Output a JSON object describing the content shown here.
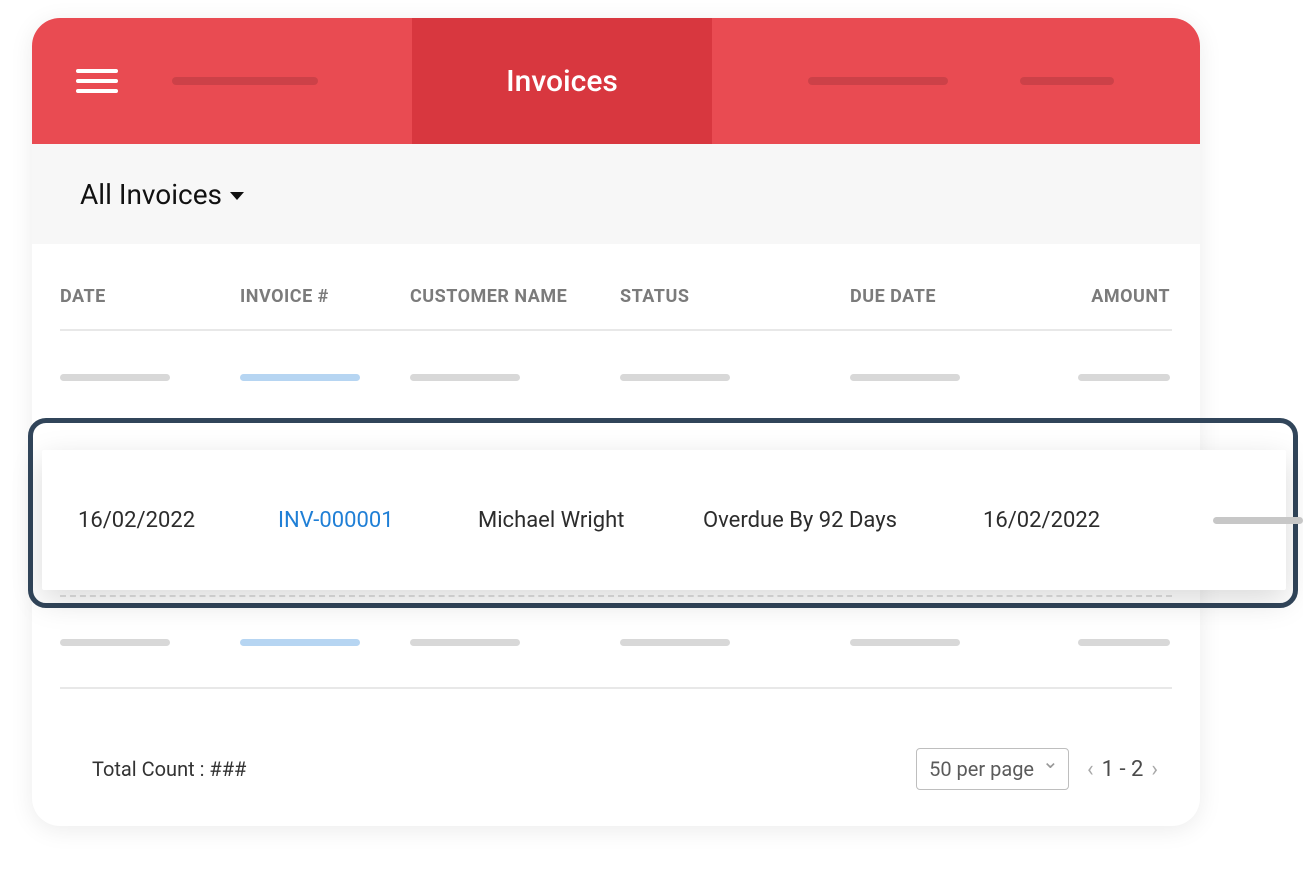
{
  "header": {
    "active_tab_label": "Invoices"
  },
  "filter": {
    "label": "All Invoices"
  },
  "table": {
    "columns": {
      "date": "DATE",
      "invoice": "INVOICE #",
      "customer": "CUSTOMER NAME",
      "status": "STATUS",
      "due_date": "DUE DATE",
      "amount": "AMOUNT"
    }
  },
  "highlighted_row": {
    "date": "16/02/2022",
    "invoice_number": "INV-000001",
    "customer_name": "Michael Wright",
    "status": "Overdue By 92 Days",
    "due_date": "16/02/2022"
  },
  "footer": {
    "total_count_label": "Total Count : ###",
    "per_page_label": "50 per page",
    "page_range": "1 - 2"
  }
}
